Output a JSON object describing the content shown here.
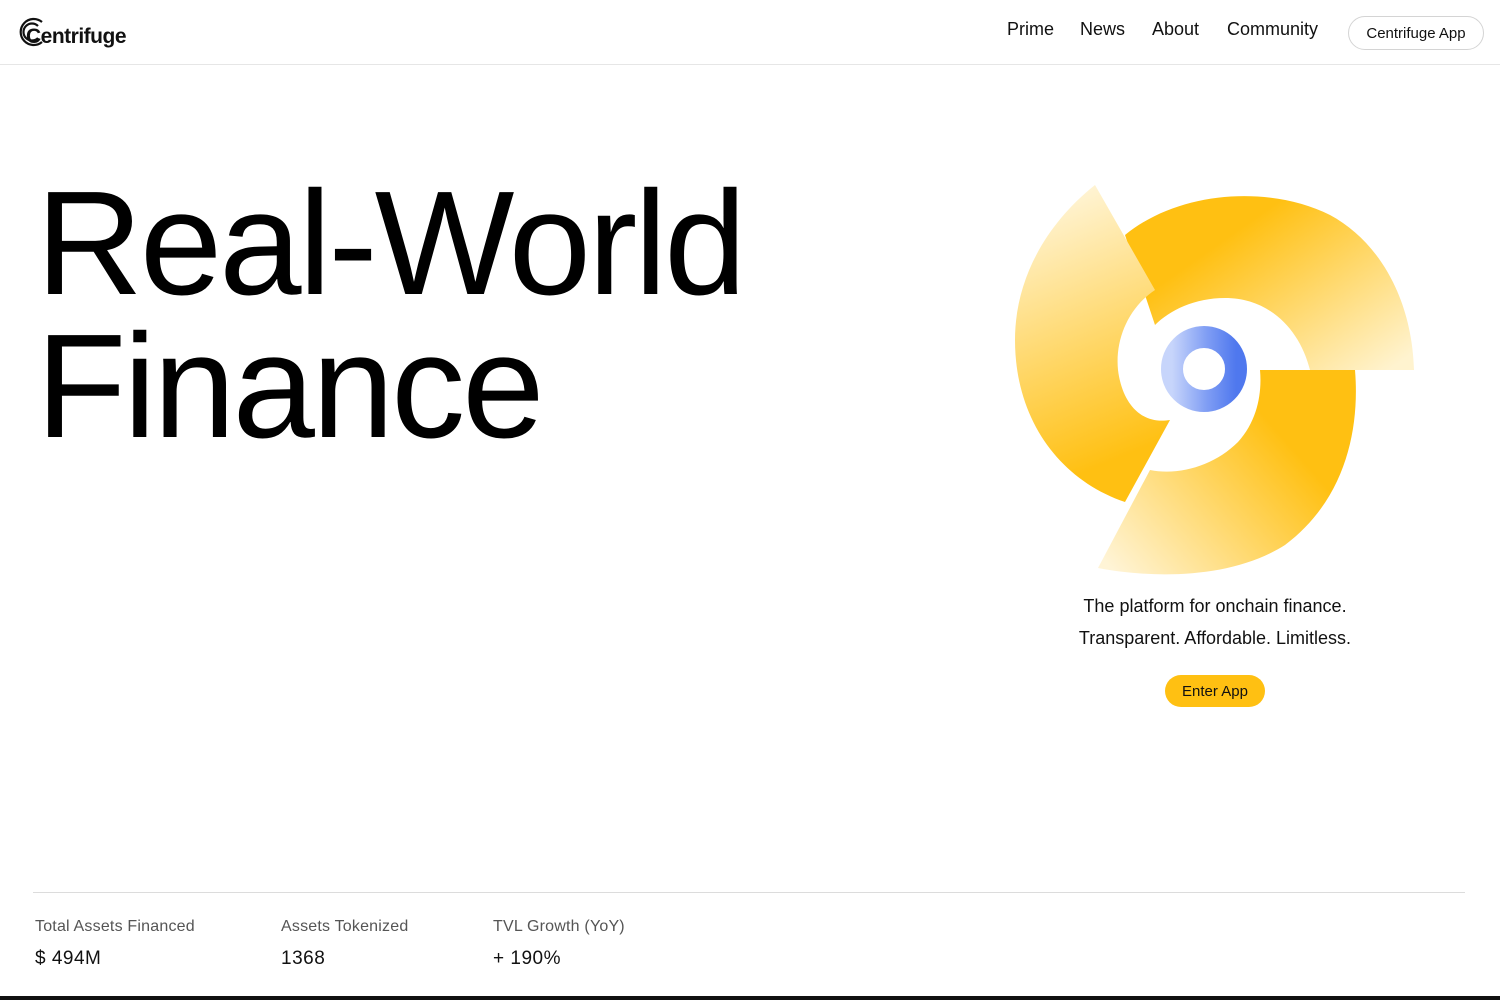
{
  "header": {
    "logo_text": "Centrifuge",
    "nav": [
      "Prime",
      "News",
      "About",
      "Community"
    ],
    "app_button": "Centrifuge App"
  },
  "hero": {
    "title_line1": "Real-World",
    "title_line2": "Finance",
    "tagline_line1": "The platform for onchain finance.",
    "tagline_line2": "Transparent. Affordable. Limitless.",
    "cta": "Enter App"
  },
  "stats": [
    {
      "label": "Total Assets Financed",
      "value": "$ 494M"
    },
    {
      "label": "Assets Tokenized",
      "value": "1368"
    },
    {
      "label": "TVL Growth (YoY)",
      "value": "+ 190%"
    }
  ],
  "colors": {
    "accent_yellow": "#ffc012",
    "accent_blue": "#5b82f0",
    "text": "#111111"
  },
  "icons": {
    "logo": "centrifuge-logo-icon",
    "hero_graphic": "centrifuge-swirl-illustration"
  }
}
